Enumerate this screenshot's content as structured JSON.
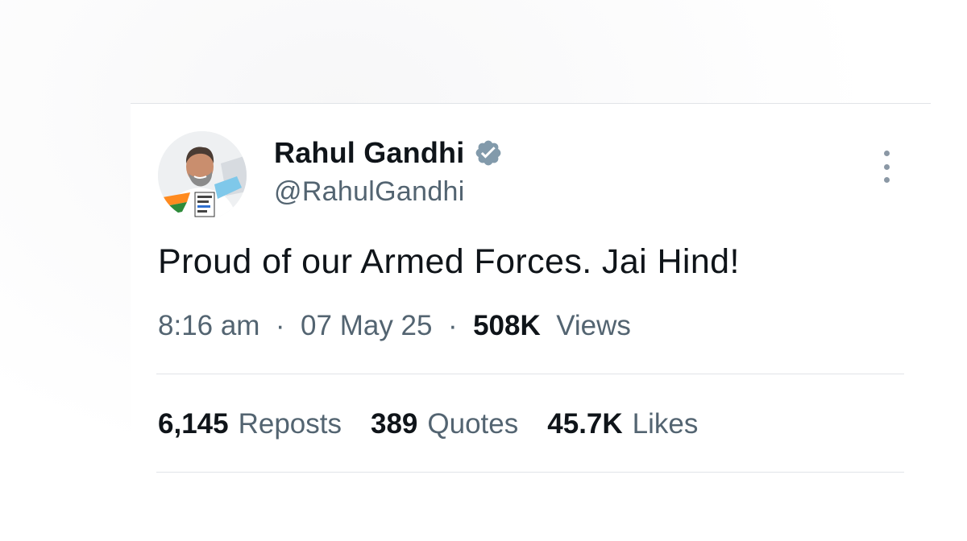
{
  "tweet": {
    "author": {
      "display_name": "Rahul Gandhi",
      "handle": "@RahulGandhi",
      "verified_icon": "verified-badge-icon",
      "verified_color": "#829aab"
    },
    "text": "Proud of our Armed Forces. Jai Hind!",
    "time": "8:16 am",
    "date": "07 May 25",
    "separator": "·",
    "views_count": "508K",
    "views_label": "Views",
    "stats": [
      {
        "count": "6,145",
        "label": "Reposts"
      },
      {
        "count": "389",
        "label": "Quotes"
      },
      {
        "count": "45.7K",
        "label": "Likes"
      }
    ],
    "more_icon": "more-vertical-icon"
  },
  "colors": {
    "text_primary": "#0f1419",
    "text_secondary": "#536471",
    "divider": "#e1e4e8"
  }
}
